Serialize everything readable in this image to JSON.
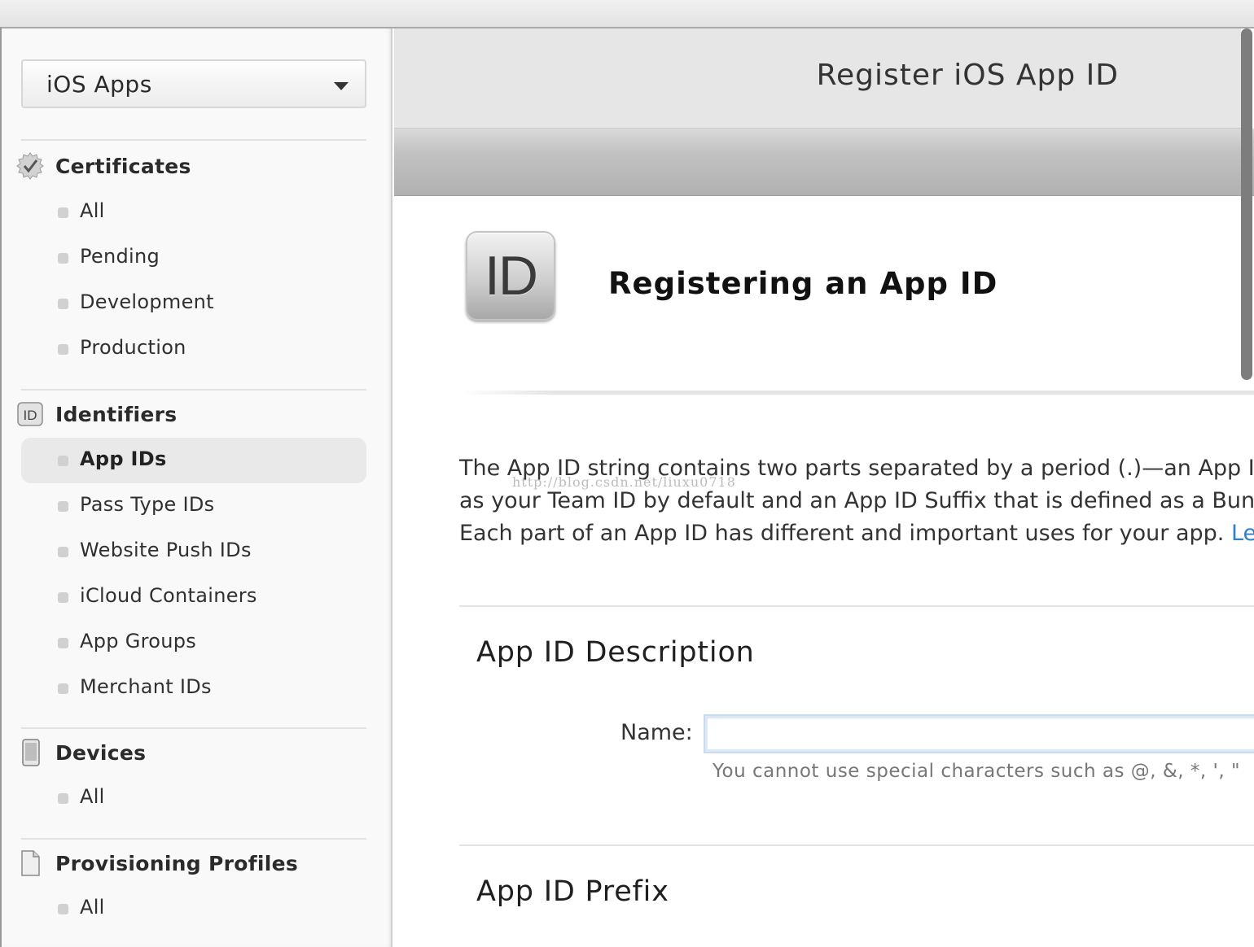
{
  "sidebar": {
    "app_type": "iOS Apps",
    "sections": [
      {
        "key": "certificates",
        "label": "Certificates",
        "icon": "certificate-badge-icon",
        "items": [
          "All",
          "Pending",
          "Development",
          "Production"
        ]
      },
      {
        "key": "identifiers",
        "label": "Identifiers",
        "icon": "id-icon",
        "icon_text": "ID",
        "items": [
          "App IDs",
          "Pass Type IDs",
          "Website Push IDs",
          "iCloud Containers",
          "App Groups",
          "Merchant IDs"
        ],
        "active_item": "App IDs"
      },
      {
        "key": "devices",
        "label": "Devices",
        "icon": "tablet-device-icon",
        "items": [
          "All"
        ]
      },
      {
        "key": "provisioning",
        "label": "Provisioning Profiles",
        "icon": "document-icon",
        "items": [
          "All"
        ]
      }
    ]
  },
  "header": {
    "title": "Register iOS App ID"
  },
  "content": {
    "badge_text": "ID",
    "heading": "Registering an App ID",
    "intro_lines": [
      "The App ID string contains two parts separated by a period (.)—an App ID",
      "as your Team ID by default and an App ID Suffix that is defined as a Bundl",
      "Each part of an App ID has different and important uses for your app."
    ],
    "learn_link": "Lear",
    "watermark": "http://blog.csdn.net/liuxu0718",
    "description_section": {
      "title": "App ID Description",
      "name_label": "Name:",
      "name_value": "",
      "hint": "You cannot use special characters such as @, &, *, ', \""
    },
    "prefix_section": {
      "title": "App ID Prefix"
    }
  },
  "colors": {
    "link": "#2f7fcc",
    "active_item_bg": "#e9e9e9",
    "header_bg": "#e6e6e6"
  }
}
